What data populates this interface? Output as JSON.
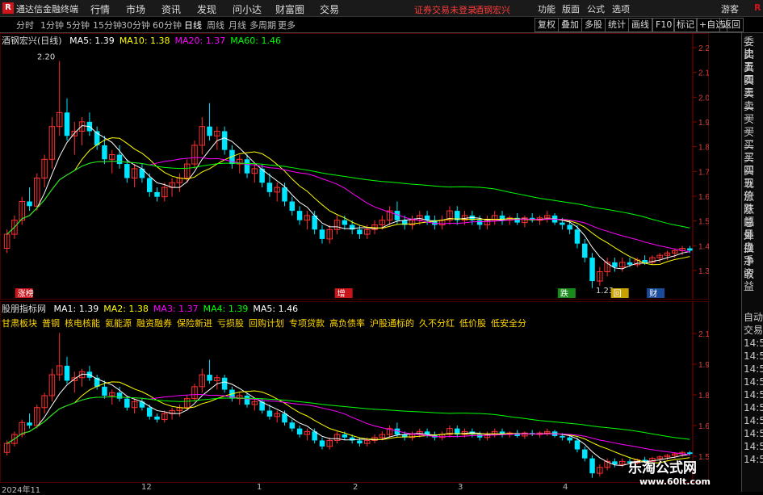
{
  "topbar": {
    "logo": "R",
    "app_name": "通达信金融终端",
    "menus": [
      "行情",
      "市场",
      "资讯",
      "发现",
      "问小达",
      "财富圈",
      "交易"
    ],
    "warning": "证券交易未登录",
    "warning_stock": "酒钢宏兴",
    "right_menus": [
      "功能",
      "版面",
      "公式",
      "选项"
    ],
    "user": "游客",
    "right_icon": "R"
  },
  "period_tabs": [
    "分时",
    "1分钟",
    "5分钟",
    "15分钟",
    "30分钟",
    "60分钟",
    "日线",
    "周线",
    "月线",
    "多周期",
    "更多"
  ],
  "period_active": "日线",
  "tool_buttons": [
    "复权",
    "叠加",
    "多股",
    "统计",
    "画线",
    "F10",
    "标记",
    "+自选",
    "返回"
  ],
  "price_panel": {
    "title": "酒钢宏兴(日线)",
    "legend": [
      {
        "label": "MA5: 1.39",
        "color": "#ffffff"
      },
      {
        "label": "MA10: 1.38",
        "color": "#ffff00"
      },
      {
        "label": "MA20: 1.37",
        "color": "#ff00ff"
      },
      {
        "label": "MA60: 1.46",
        "color": "#00ff00"
      }
    ],
    "y_ticks": [
      "2.20",
      "2.10",
      "2.00",
      "1.90",
      "1.80",
      "1.70",
      "1.60",
      "1.50",
      "1.40",
      "1.30"
    ],
    "y_min": 1.25,
    "y_max": 2.25,
    "high_label": "2.20",
    "low_label": "1.23",
    "markers": [
      {
        "text": "涨榜",
        "bg": "#c8141b",
        "x_frac": 0.022
      },
      {
        "text": "增",
        "bg": "#c8141b",
        "x_frac": 0.485
      },
      {
        "text": "跌",
        "bg": "#1a8a1a",
        "x_frac": 0.808
      },
      {
        "text": "回",
        "bg": "#c8a000",
        "x_frac": 0.885
      },
      {
        "text": "财",
        "bg": "#1a4a9a",
        "x_frac": 0.937
      }
    ]
  },
  "indicator_panel": {
    "title": "股朋指标网",
    "legend": [
      {
        "label": "MA1: 1.39",
        "color": "#ffffff"
      },
      {
        "label": "MA2: 1.38",
        "color": "#ffff00"
      },
      {
        "label": "MA3: 1.37",
        "color": "#ff00ff"
      },
      {
        "label": "MA4: 1.39",
        "color": "#00ff00"
      },
      {
        "label": "MA5: 1.46",
        "color": "#ffffff"
      }
    ],
    "tags": [
      "甘肃板块",
      "普钢",
      "核电核能",
      "氦能源",
      "融资融券",
      "保险新进",
      "亏损股",
      "回购计划",
      "专项贷款",
      "高负债率",
      "沪股通标的",
      "久不分红",
      "低价股",
      "低安全分"
    ],
    "y_ticks": [
      "2.10",
      "1.95",
      "1.80",
      "1.65",
      "1.50"
    ]
  },
  "bottom_axis": [
    "2024年11",
    "12",
    "1",
    "2",
    "3",
    "4"
  ],
  "right_panel": {
    "items": [
      "委比",
      "卖五",
      "卖四",
      "卖三",
      "卖二",
      "卖一",
      "买一",
      "买二",
      "买三",
      "买四",
      "买五",
      "现价",
      "涨跌",
      "涨幅",
      "总量",
      "外盘",
      "换手",
      "净资",
      "收益"
    ],
    "items2": [
      "自动",
      "交易",
      "14:5",
      "14:5",
      "14:5",
      "14:5",
      "14:5",
      "14:5",
      "14:5",
      "14:5",
      "14:5",
      "14:5"
    ]
  },
  "watermark": {
    "line1": "乐淘公式网",
    "line2": "www.60lt.com"
  },
  "chart_data": {
    "type": "candlestick",
    "title": "酒钢宏兴(日线)",
    "ylim": [
      1.25,
      2.25
    ],
    "candles": [
      [
        1.4,
        1.48,
        1.38,
        1.46
      ],
      [
        1.46,
        1.54,
        1.44,
        1.52
      ],
      [
        1.52,
        1.62,
        1.5,
        1.6
      ],
      [
        1.6,
        1.66,
        1.56,
        1.58
      ],
      [
        1.58,
        1.72,
        1.56,
        1.7
      ],
      [
        1.7,
        1.8,
        1.66,
        1.78
      ],
      [
        1.78,
        1.96,
        1.74,
        1.92
      ],
      [
        1.92,
        2.2,
        1.88,
        1.98
      ],
      [
        1.98,
        2.04,
        1.86,
        1.88
      ],
      [
        1.88,
        1.94,
        1.8,
        1.9
      ],
      [
        1.9,
        1.96,
        1.84,
        1.94
      ],
      [
        1.94,
        1.98,
        1.88,
        1.9
      ],
      [
        1.9,
        1.92,
        1.82,
        1.84
      ],
      [
        1.84,
        1.88,
        1.76,
        1.78
      ],
      [
        1.78,
        1.82,
        1.72,
        1.8
      ],
      [
        1.8,
        1.84,
        1.74,
        1.76
      ],
      [
        1.76,
        1.78,
        1.68,
        1.7
      ],
      [
        1.7,
        1.76,
        1.66,
        1.74
      ],
      [
        1.74,
        1.76,
        1.68,
        1.7
      ],
      [
        1.7,
        1.72,
        1.62,
        1.64
      ],
      [
        1.64,
        1.66,
        1.6,
        1.62
      ],
      [
        1.62,
        1.68,
        1.6,
        1.66
      ],
      [
        1.66,
        1.7,
        1.62,
        1.68
      ],
      [
        1.68,
        1.72,
        1.64,
        1.7
      ],
      [
        1.7,
        1.78,
        1.68,
        1.76
      ],
      [
        1.76,
        1.86,
        1.74,
        1.84
      ],
      [
        1.84,
        1.96,
        1.8,
        1.92
      ],
      [
        1.92,
        2.02,
        1.86,
        1.88
      ],
      [
        1.88,
        1.92,
        1.82,
        1.9
      ],
      [
        1.9,
        1.92,
        1.8,
        1.82
      ],
      [
        1.82,
        1.84,
        1.74,
        1.76
      ],
      [
        1.76,
        1.8,
        1.72,
        1.78
      ],
      [
        1.78,
        1.8,
        1.7,
        1.72
      ],
      [
        1.72,
        1.76,
        1.68,
        1.74
      ],
      [
        1.74,
        1.76,
        1.66,
        1.68
      ],
      [
        1.68,
        1.72,
        1.62,
        1.64
      ],
      [
        1.64,
        1.68,
        1.6,
        1.66
      ],
      [
        1.66,
        1.68,
        1.58,
        1.6
      ],
      [
        1.6,
        1.62,
        1.54,
        1.56
      ],
      [
        1.56,
        1.58,
        1.5,
        1.52
      ],
      [
        1.52,
        1.56,
        1.48,
        1.54
      ],
      [
        1.54,
        1.56,
        1.46,
        1.48
      ],
      [
        1.48,
        1.5,
        1.42,
        1.44
      ],
      [
        1.44,
        1.5,
        1.42,
        1.48
      ],
      [
        1.48,
        1.54,
        1.46,
        1.52
      ],
      [
        1.52,
        1.54,
        1.48,
        1.5
      ],
      [
        1.5,
        1.52,
        1.46,
        1.48
      ],
      [
        1.48,
        1.5,
        1.44,
        1.46
      ],
      [
        1.46,
        1.5,
        1.44,
        1.48
      ],
      [
        1.48,
        1.52,
        1.46,
        1.5
      ],
      [
        1.5,
        1.54,
        1.48,
        1.52
      ],
      [
        1.52,
        1.58,
        1.5,
        1.56
      ],
      [
        1.56,
        1.6,
        1.5,
        1.52
      ],
      [
        1.52,
        1.54,
        1.48,
        1.5
      ],
      [
        1.5,
        1.54,
        1.48,
        1.52
      ],
      [
        1.52,
        1.56,
        1.5,
        1.54
      ],
      [
        1.54,
        1.56,
        1.5,
        1.52
      ],
      [
        1.52,
        1.54,
        1.48,
        1.5
      ],
      [
        1.5,
        1.54,
        1.48,
        1.52
      ],
      [
        1.52,
        1.58,
        1.5,
        1.56
      ],
      [
        1.56,
        1.58,
        1.5,
        1.52
      ],
      [
        1.52,
        1.56,
        1.5,
        1.54
      ],
      [
        1.54,
        1.56,
        1.5,
        1.52
      ],
      [
        1.52,
        1.54,
        1.48,
        1.5
      ],
      [
        1.5,
        1.54,
        1.48,
        1.52
      ],
      [
        1.52,
        1.56,
        1.5,
        1.54
      ],
      [
        1.54,
        1.56,
        1.5,
        1.52
      ],
      [
        1.52,
        1.54,
        1.5,
        1.53
      ],
      [
        1.53,
        1.55,
        1.5,
        1.51
      ],
      [
        1.51,
        1.54,
        1.49,
        1.53
      ],
      [
        1.53,
        1.55,
        1.51,
        1.52
      ],
      [
        1.52,
        1.54,
        1.5,
        1.53
      ],
      [
        1.53,
        1.56,
        1.51,
        1.54
      ],
      [
        1.54,
        1.55,
        1.5,
        1.51
      ],
      [
        1.51,
        1.53,
        1.48,
        1.5
      ],
      [
        1.5,
        1.52,
        1.46,
        1.48
      ],
      [
        1.48,
        1.5,
        1.4,
        1.42
      ],
      [
        1.42,
        1.44,
        1.34,
        1.36
      ],
      [
        1.36,
        1.38,
        1.23,
        1.26
      ],
      [
        1.26,
        1.32,
        1.24,
        1.3
      ],
      [
        1.3,
        1.36,
        1.28,
        1.34
      ],
      [
        1.34,
        1.36,
        1.3,
        1.32
      ],
      [
        1.32,
        1.36,
        1.3,
        1.34
      ],
      [
        1.34,
        1.36,
        1.32,
        1.33
      ],
      [
        1.33,
        1.36,
        1.32,
        1.35
      ],
      [
        1.35,
        1.37,
        1.33,
        1.34
      ],
      [
        1.34,
        1.37,
        1.33,
        1.36
      ],
      [
        1.36,
        1.38,
        1.34,
        1.37
      ],
      [
        1.37,
        1.39,
        1.35,
        1.38
      ],
      [
        1.38,
        1.4,
        1.36,
        1.39
      ],
      [
        1.39,
        1.41,
        1.37,
        1.4
      ],
      [
        1.4,
        1.41,
        1.38,
        1.39
      ]
    ]
  }
}
